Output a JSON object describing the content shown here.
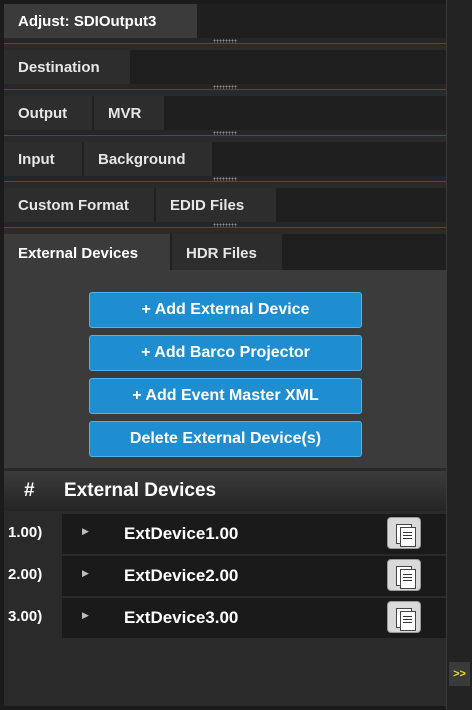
{
  "adjust": {
    "title": "Adjust: SDIOutput3"
  },
  "sections": {
    "destination": "Destination",
    "output": "Output",
    "mvr": "MVR",
    "input": "Input",
    "background": "Background",
    "custom_format": "Custom Format",
    "edid_files": "EDID Files",
    "external_devices": "External Devices",
    "hdr_files": "HDR Files"
  },
  "buttons": {
    "add_external_device": "+ Add External Device",
    "add_barco_projector": "+ Add Barco Projector",
    "add_event_master_xml": "+ Add Event Master XML",
    "delete_external_devices": "Delete External Device(s)"
  },
  "list": {
    "hash": "#",
    "title": "External Devices",
    "rows": [
      {
        "index": "1.00)",
        "name": "ExtDevice1.00"
      },
      {
        "index": "2.00)",
        "name": "ExtDevice2.00"
      },
      {
        "index": "3.00)",
        "name": "ExtDevice3.00"
      }
    ]
  },
  "expander": ">>"
}
